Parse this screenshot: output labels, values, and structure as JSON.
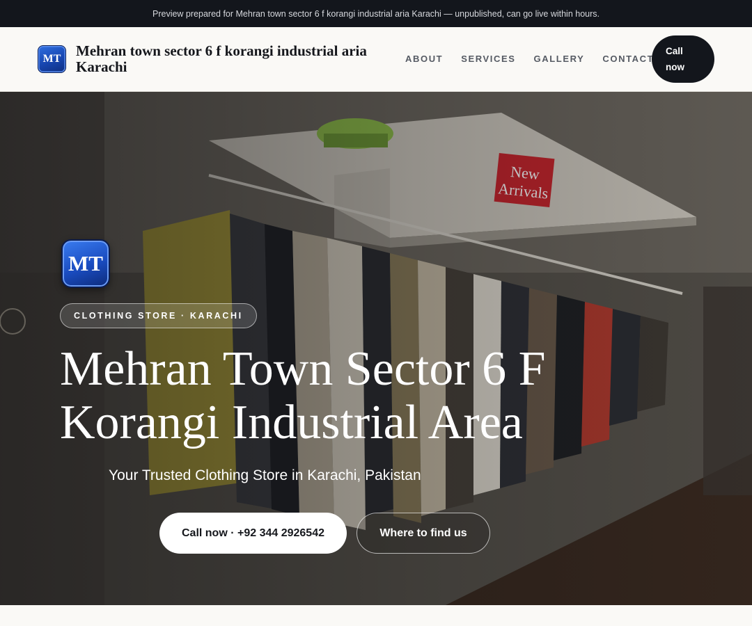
{
  "topbar": {
    "notice": "Preview prepared for Mehran town sector 6 f korangi industrial aria Karachi — unpublished, can go live within hours."
  },
  "header": {
    "logo_initials": "MT",
    "brand_name": "Mehran town sector 6 f korangi industrial aria Karachi",
    "nav": [
      {
        "label": "ABOUT"
      },
      {
        "label": "SERVICES"
      },
      {
        "label": "GALLERY"
      },
      {
        "label": "CONTACT"
      }
    ],
    "call_label": "Call now"
  },
  "hero": {
    "logo_initials": "MT",
    "category_pill": "CLOTHING STORE · KARACHI",
    "title": "Mehran Town Sector 6 F Korangi Industrial Area",
    "subtitle": "Your Trusted Clothing Store in Karachi, Pakistan",
    "primary_button": "Call now · +92 344 2926542",
    "secondary_button": "Where to find us",
    "background_sign": "New Arrivals"
  },
  "colors": {
    "topbar_bg": "#13161c",
    "header_bg": "#faf9f6",
    "logo_blue": "#1a4cc0",
    "accent_dark": "#13161c"
  }
}
